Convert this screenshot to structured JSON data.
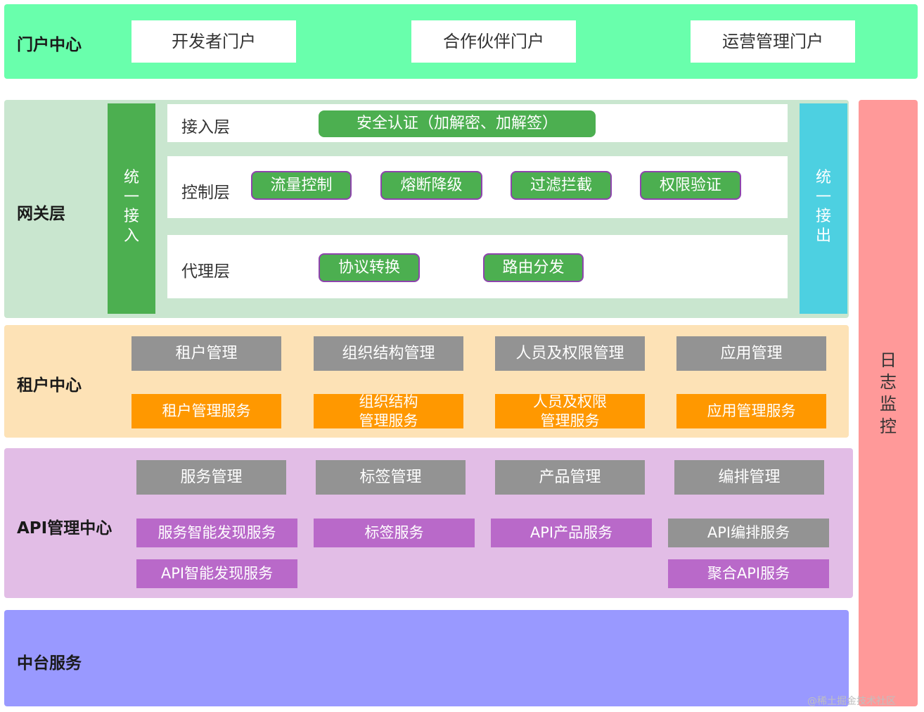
{
  "colors": {
    "portal_bg": "#69ffac",
    "gateway_bg": "#c9e6cf",
    "tenant_bg": "#fde2b6",
    "api_bg": "#e2bde6",
    "midplatform_bg": "#9999ff",
    "log_bg": "#ff9999",
    "unified_in": "#4caf50",
    "unified_out": "#4dd0e1",
    "grey": "#939393",
    "orange": "#ff9800",
    "purple": "#b969c9"
  },
  "portal": {
    "title": "门户中心",
    "buttons": [
      "开发者门户",
      "合作伙伴门户",
      "运营管理门户"
    ]
  },
  "gateway": {
    "title": "网关层",
    "unified_in": [
      "统",
      "一",
      "接",
      "入"
    ],
    "unified_out": [
      "统",
      "一",
      "接",
      "出"
    ],
    "access_layer": {
      "label": "接入层",
      "items": [
        "安全认证（加解密、加解签）"
      ]
    },
    "control_layer": {
      "label": "控制层",
      "items": [
        "流量控制",
        "熔断降级",
        "过滤拦截",
        "权限验证"
      ]
    },
    "proxy_layer": {
      "label": "代理层",
      "items": [
        "协议转换",
        "路由分发"
      ]
    }
  },
  "tenant": {
    "title": "租户中心",
    "management": [
      "租户管理",
      "组织结构管理",
      "人员及权限管理",
      "应用管理"
    ],
    "services": [
      "租户管理服务",
      "组织结构\n管理服务",
      "人员及权限\n管理服务",
      "应用管理服务"
    ]
  },
  "api_center": {
    "title": "API管理中心",
    "management": [
      "服务管理",
      "标签管理",
      "产品管理",
      "编排管理"
    ],
    "services_row1": [
      "服务智能发现服务",
      "标签服务",
      "API产品服务",
      "API编排服务"
    ],
    "services_row2": [
      "API智能发现服务",
      "聚合API服务"
    ]
  },
  "mid_platform": {
    "title": "中台服务"
  },
  "log_monitor": {
    "chars": [
      "日",
      "志",
      "监",
      "控"
    ]
  },
  "watermark": "@稀土掘金技术社区"
}
